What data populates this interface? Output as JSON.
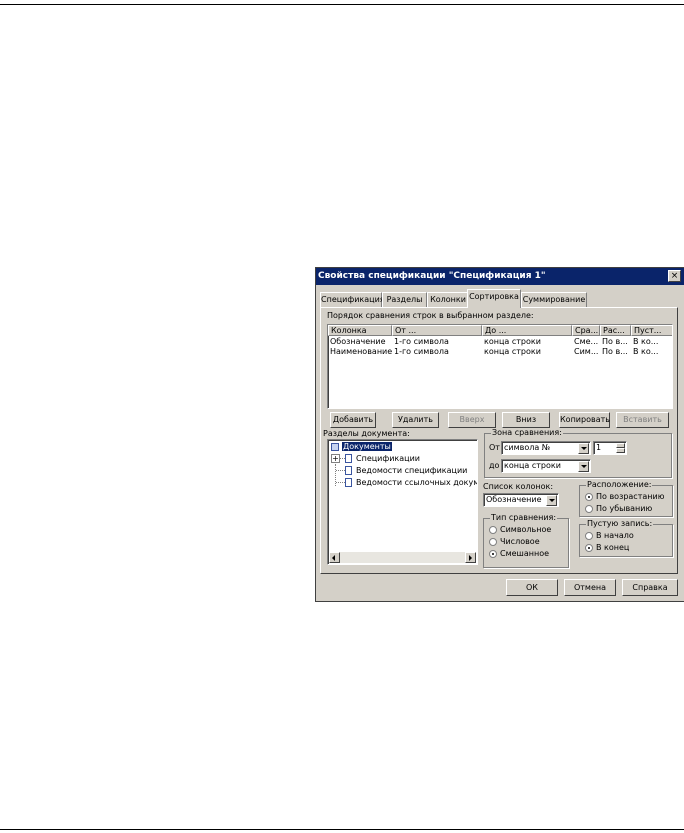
{
  "dialog": {
    "title": "Свойства спецификации \"Спецификация 1\"",
    "close_glyph": "×",
    "tabs": [
      "Спецификация",
      "Разделы",
      "Колонки",
      "Сортировка",
      "Суммирование"
    ],
    "active_tab": "Сортировка",
    "order_label": "Порядок сравнения строк в выбранном разделе:",
    "table": {
      "headers": [
        "Колонка",
        "От ...",
        "До ...",
        "Сра...",
        "Рас...",
        "Пуст..."
      ],
      "rows": [
        [
          "Обозначение",
          "1-го символа",
          "конца строки",
          "Сме...",
          "По в...",
          "В ко..."
        ],
        [
          "Наименование",
          "1-го символа",
          "конца строки",
          "Сим...",
          "По в...",
          "В ко..."
        ]
      ]
    },
    "buttons": {
      "add": "Добавить",
      "delete": "Удалить",
      "up": "Вверх",
      "down": "Вниз",
      "copy": "Копировать",
      "paste": "Вставить"
    },
    "sections": {
      "label": "Разделы документа:",
      "items": [
        "Документы",
        "Спецификации",
        "Ведомости спецификации",
        "Ведомости ссылочных докум"
      ]
    },
    "zone": {
      "title": "Зона сравнения:",
      "from_label": "От",
      "from_value": "символа №",
      "spin_value": "1",
      "to_label": "до",
      "to_value": "конца строки"
    },
    "columns": {
      "label": "Список колонок:",
      "value": "Обозначение"
    },
    "compare_type": {
      "title": "Тип сравнения:",
      "options": [
        "Символьное",
        "Числовое",
        "Смешанное"
      ],
      "selected": "Смешанное"
    },
    "arrangement": {
      "title": "Расположение:",
      "options": [
        "По возрастанию",
        "По убыванию"
      ],
      "selected": "По возрастанию"
    },
    "empty_record": {
      "title": "Пустую запись:",
      "options": [
        "В начало",
        "В конец"
      ],
      "selected": "В конец"
    },
    "footer": {
      "ok": "ОК",
      "cancel": "Отмена",
      "help": "Справка"
    }
  }
}
